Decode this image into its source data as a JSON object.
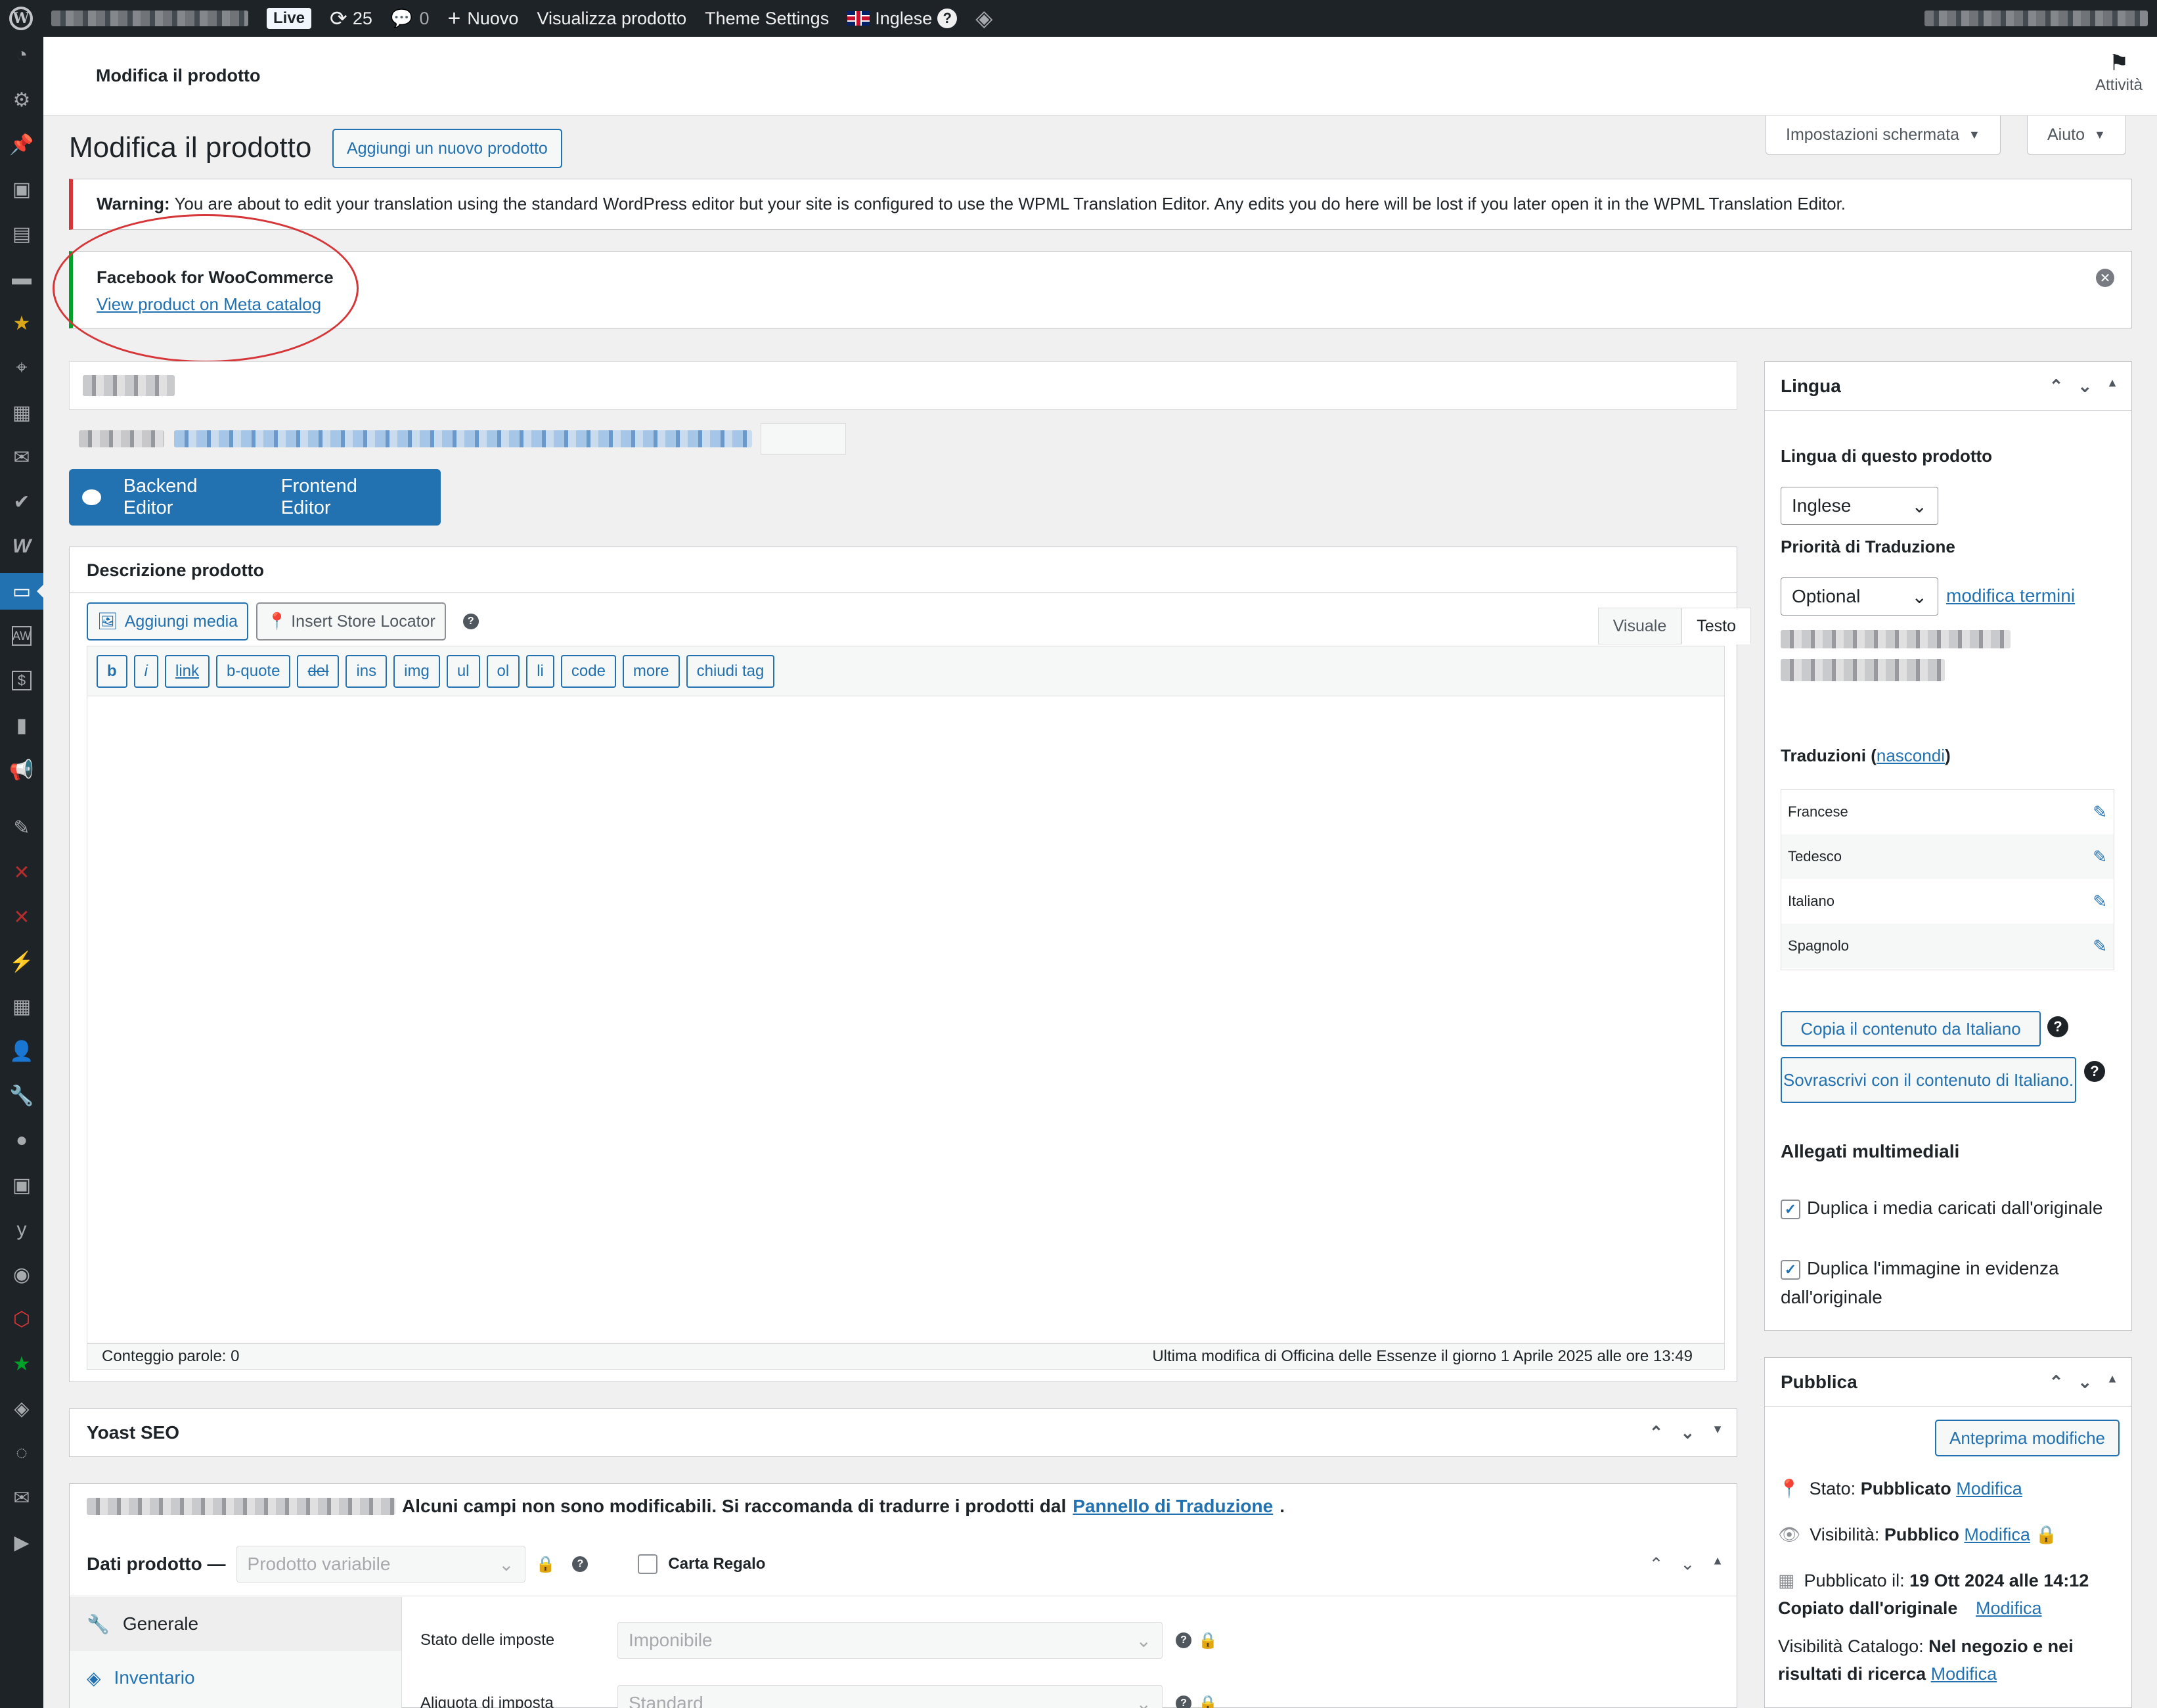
{
  "admin_bar": {
    "live_badge": "Live",
    "updates_count": "25",
    "comments_count": "0",
    "new_label": "Nuovo",
    "view_product": "Visualizza prodotto",
    "theme_settings": "Theme Settings",
    "language": "Inglese"
  },
  "header": {
    "title": "Modifica il prodotto",
    "activity": "Attività"
  },
  "screen_options": "Impostazioni schermata",
  "help": "Aiuto",
  "page": {
    "title": "Modifica il prodotto",
    "add_new": "Aggiungi un nuovo prodotto"
  },
  "warning": {
    "prefix": "Warning:",
    "text": "You are about to edit your translation using the standard WordPress editor but your site is configured to use the WPML Translation Editor. Any edits you do here will be lost if you later open it in the WPML Translation Editor."
  },
  "fb_notice": {
    "title": "Facebook for WooCommerce",
    "link": "View product on Meta catalog"
  },
  "builder": {
    "backend": "Backend Editor",
    "frontend": "Frontend Editor"
  },
  "description_box": {
    "title": "Descrizione prodotto",
    "add_media": "Aggiungi media",
    "store_locator": "Insert Store Locator",
    "tab_visual": "Visuale",
    "tab_text": "Testo",
    "quicktags": [
      "b",
      "i",
      "link",
      "b-quote",
      "del",
      "ins",
      "img",
      "ul",
      "ol",
      "li",
      "code",
      "more",
      "chiudi tag"
    ],
    "word_count": "Conteggio parole: 0",
    "last_modified": "Ultima modifica di Officina delle Essenze il giorno 1 Aprile 2025 alle ore 13:49"
  },
  "yoast": {
    "title": "Yoast SEO"
  },
  "product_data": {
    "wpml_note": "Alcuni campi non sono modificabili. Si raccomanda di tradurre i prodotti dal",
    "wpml_link": "Pannello di Traduzione",
    "label": "Dati prodotto —",
    "type_value": "Prodotto variabile",
    "gift_card": "Carta Regalo",
    "tabs": [
      "Generale",
      "Inventario"
    ],
    "fields": [
      {
        "label": "Stato delle imposte",
        "value": "Imponibile"
      },
      {
        "label": "Aliquota di imposta",
        "value": "Standard"
      }
    ]
  },
  "lingua": {
    "title": "Lingua",
    "language_label": "Lingua di questo prodotto",
    "language_value": "Inglese",
    "priority_label": "Priorità di Traduzione",
    "priority_value": "Optional",
    "edit_terms": "modifica termini",
    "translations_label": "Traduzioni (",
    "translations_hide": "nascondi",
    "translations_close": ")",
    "translations": [
      "Francese",
      "Tedesco",
      "Italiano",
      "Spagnolo"
    ],
    "copy_button": "Copia il contenuto da Italiano",
    "overwrite_button": "Sovrascrivi con il contenuto di Italiano.",
    "media_title": "Allegati multimediali",
    "dup_media": "Duplica i media caricati dall'originale",
    "dup_featured": "Duplica l'immagine in evidenza dall'originale"
  },
  "pubblica": {
    "title": "Pubblica",
    "preview": "Anteprima modifiche",
    "status_label": "Stato:",
    "status_value": "Pubblicato",
    "visibility_label": "Visibilità:",
    "visibility_value": "Pubblico",
    "published_label": "Pubblicato il:",
    "published_value": "19 Ott 2024 alle 14:12 Copiato dall'originale",
    "catalog_label": "Visibilità Catalogo:",
    "catalog_value": "Nel negozio e nei risultati di ricerca",
    "edit": "Modifica"
  },
  "colors": {
    "admin_bar": "#1d2327",
    "accent": "#2271b1",
    "warning_border": "#d63638",
    "success_border": "#00a32a"
  }
}
